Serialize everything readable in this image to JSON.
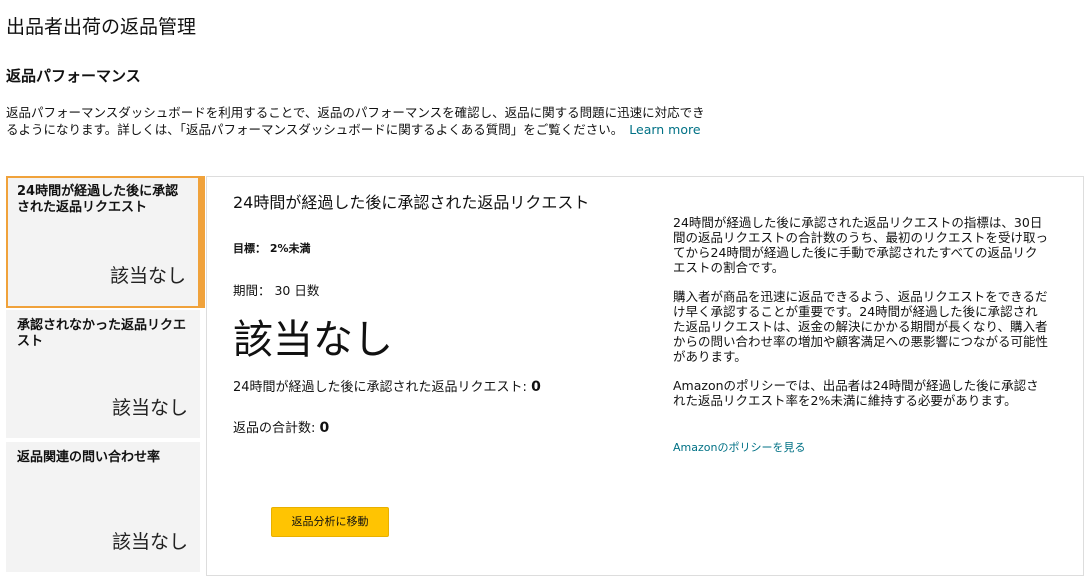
{
  "page": {
    "title": "出品者出荷の返品管理"
  },
  "section": {
    "title": "返品パフォーマンス",
    "intro": "返品パフォーマンスダッシュボードを利用することで、返品のパフォーマンスを確認し、返品に関する問題に迅速に対応できるようになります。詳しくは、「返品パフォーマンスダッシュボードに関するよくある質問」をご覧ください。",
    "learn_more": "Learn more"
  },
  "metrics": [
    {
      "title": "24時間が経過した後に承認された返品リクエスト",
      "value": "該当なし",
      "selected": true
    },
    {
      "title": "承認されなかった返品リクエスト",
      "value": "該当なし",
      "selected": false
    },
    {
      "title": "返品関連の問い合わせ率",
      "value": "該当なし",
      "selected": false
    }
  ],
  "detail": {
    "title": "24時間が経過した後に承認された返品リクエスト",
    "target": "目標： 2%未満",
    "period": "期間： 30 日数",
    "value": "該当なし",
    "late_label": "24時間が経過した後に承認された返品リクエスト: ",
    "late_count": "0",
    "total_label": "返品の合計数: ",
    "total_count": "0",
    "desc_1": "24時間が経過した後に承認された返品リクエストの指標は、30日間の返品リクエストの合計数のうち、最初のリクエストを受け取ってから24時間が経過した後に手動で承認されたすべての返品リクエストの割合です。",
    "desc_2": "購入者が商品を迅速に返品できるよう、返品リクエストをできるだけ早く承認することが重要です。24時間が経過した後に承認された返品リクエストは、返金の解決にかかる期間が長くなり、購入者からの問い合わせ率の増加や顧客満足への悪影響につながる可能性があります。",
    "desc_3": "Amazonのポリシーでは、出品者は24時間が経過した後に承認された返品リクエスト率を2%未満に維持する必要があります。",
    "policy_link": "Amazonのポリシーを見る",
    "button": "返品分析に移動"
  },
  "colors": {
    "accent": "#f0a23b",
    "link": "#007185",
    "button": "#ffc402",
    "card_bg": "#f3f3f3"
  }
}
